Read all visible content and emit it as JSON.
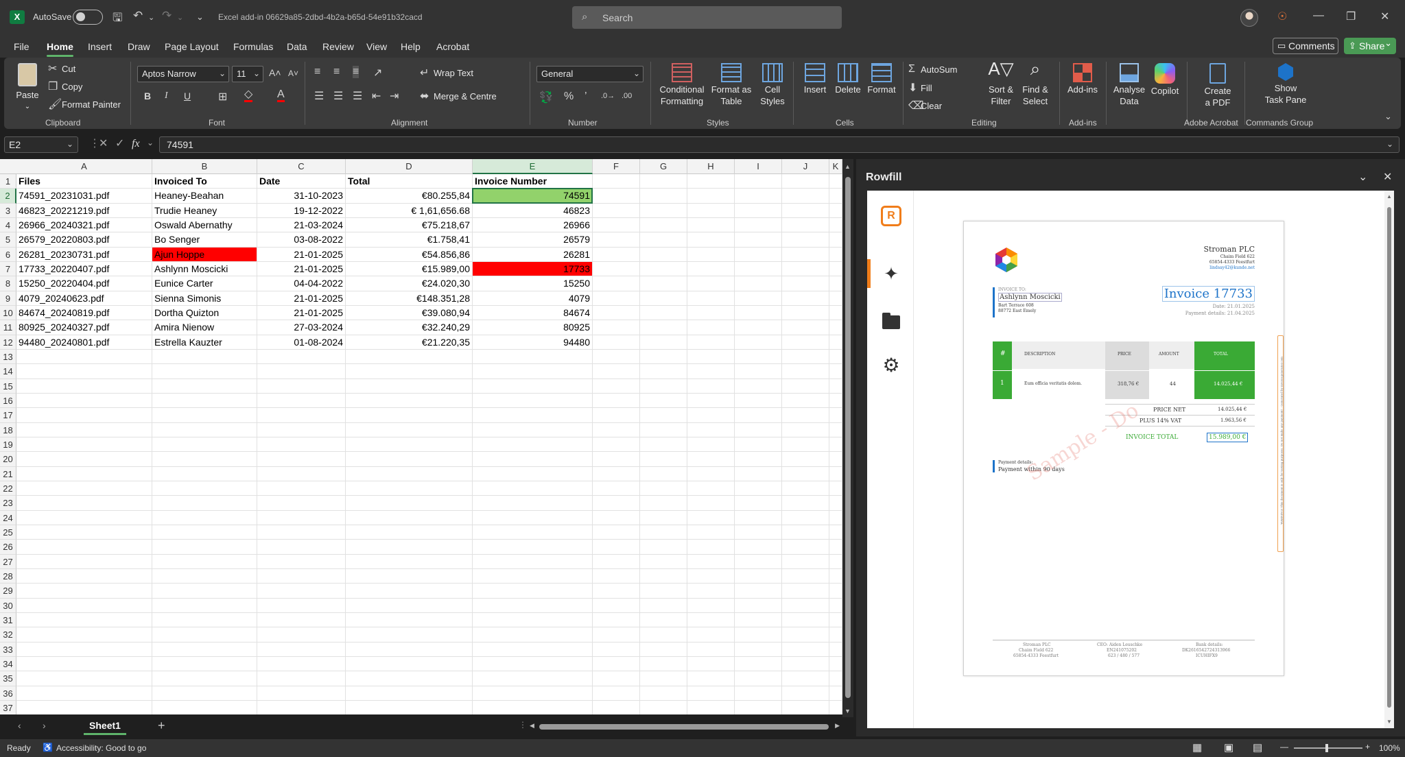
{
  "titlebar": {
    "app_logo": "X",
    "autosave_label": "AutoSave",
    "doc_title": "Excel add-in 06629a85-2dbd-4b2a-b65d-54e91b32cacd",
    "search_placeholder": "Search"
  },
  "menu": {
    "items": [
      "File",
      "Home",
      "Insert",
      "Draw",
      "Page Layout",
      "Formulas",
      "Data",
      "Review",
      "View",
      "Help",
      "Acrobat"
    ],
    "active": "Home",
    "comments_label": "Comments",
    "share_label": "Share"
  },
  "ribbon": {
    "clipboard": {
      "paste": "Paste",
      "cut": "Cut",
      "copy": "Copy",
      "format_painter": "Format Painter",
      "label": "Clipboard"
    },
    "font": {
      "family": "Aptos Narrow",
      "size": "11",
      "label": "Font"
    },
    "alignment": {
      "wrap_text": "Wrap Text",
      "merge": "Merge & Centre",
      "label": "Alignment"
    },
    "number": {
      "format": "General",
      "label": "Number"
    },
    "styles": {
      "conditional": [
        "Conditional",
        "Formatting"
      ],
      "format_table": [
        "Format as",
        "Table"
      ],
      "cell_styles": [
        "Cell",
        "Styles"
      ],
      "label": "Styles"
    },
    "cells": {
      "insert": "Insert",
      "delete": "Delete",
      "format": "Format",
      "label": "Cells"
    },
    "editing": {
      "autosum": "AutoSum",
      "fill": "Fill",
      "clear": "Clear",
      "sort": [
        "Sort &",
        "Filter"
      ],
      "find": [
        "Find &",
        "Select"
      ],
      "label": "Editing"
    },
    "addins": {
      "addins": "Add-ins",
      "label": "Add-ins"
    },
    "analyse": [
      "Analyse",
      "Data"
    ],
    "copilot": "Copilot",
    "acrobat": {
      "create": [
        "Create",
        "a PDF"
      ],
      "label": "Adobe Acrobat"
    },
    "commands": {
      "show": [
        "Show",
        "Task Pane"
      ],
      "label": "Commands Group"
    }
  },
  "formula_bar": {
    "name_box": "E2",
    "fx": "fx",
    "value": "74591"
  },
  "sheet": {
    "columns": [
      "A",
      "B",
      "C",
      "D",
      "E",
      "F",
      "G",
      "H",
      "I",
      "J",
      "K"
    ],
    "selected_column": "E",
    "selected_row": 2,
    "header": [
      "Files",
      "Invoiced To",
      "Date",
      "Total",
      "Invoice Number"
    ],
    "rows": [
      [
        "74591_20231031.pdf",
        "Heaney-Beahan",
        "31-10-2023",
        "€80.255,84",
        "74591"
      ],
      [
        "46823_20221219.pdf",
        "Trudie Heaney",
        "19-12-2022",
        "€ 1,61,656.68",
        "46823"
      ],
      [
        "26966_20240321.pdf",
        "Oswald Abernathy",
        "21-03-2024",
        "€75.218,67",
        "26966"
      ],
      [
        "26579_20220803.pdf",
        "Bo Senger",
        "03-08-2022",
        "€1.758,41",
        "26579"
      ],
      [
        "26281_20230731.pdf",
        "Ajun Hoppe",
        "21-01-2025",
        "€54.856,86",
        "26281"
      ],
      [
        "17733_20220407.pdf",
        "Ashlynn Moscicki",
        "21-01-2025",
        "€15.989,00",
        "17733"
      ],
      [
        "15250_20220404.pdf",
        "Eunice Carter",
        "04-04-2022",
        "€24.020,30",
        "15250"
      ],
      [
        "4079_20240623.pdf",
        "Sienna Simonis",
        "21-01-2025",
        "€148.351,28",
        "4079"
      ],
      [
        "84674_20240819.pdf",
        "Dortha Quizton",
        "21-01-2025",
        "€39.080,94",
        "84674"
      ],
      [
        "80925_20240327.pdf",
        "Amira Nienow",
        "27-03-2024",
        "€32.240,29",
        "80925"
      ],
      [
        "94480_20240801.pdf",
        "Estrella Kauzter",
        "01-08-2024",
        "€21.220,35",
        "94480"
      ]
    ],
    "highlights": {
      "green": "#92d26b",
      "red": "#ff0000"
    },
    "row_count": 37,
    "tab": "Sheet1"
  },
  "status": {
    "ready": "Ready",
    "accessibility": "Accessibility: Good to go",
    "zoom": "100%"
  },
  "pane": {
    "title": "Rowfill",
    "sidebar_icons": [
      "rowfill-logo-icon",
      "sparkle-icon",
      "folder-icon",
      "gear-icon"
    ],
    "invoice": {
      "company": "Stroman PLC",
      "address1": "Chaim Field 622",
      "address2": "65854-4333 Feestfurt",
      "email": "lindsay42@kunde.net",
      "invoice_to_label": "INVOICE TO:",
      "client": "Ashlynn Moscicki",
      "client_addr1": "Bart Terrace 608",
      "client_addr2": "88772 East Emely",
      "invoice_title": "Invoice 17733",
      "date": "Date: 21.01.2025",
      "payment_date": "Payment details: 21.04.2025",
      "table_head": [
        "#",
        "DESCRIPTION",
        "PRICE",
        "AMOUNT",
        "TOTAL"
      ],
      "table_row": [
        "1",
        "Eum officia veritatis dolom.",
        "318,76 €",
        "44",
        "14.025,44 €"
      ],
      "price_net_label": "PRICE NET",
      "price_net": "14.025,44 €",
      "vat_label": "PLUS 14% VAT",
      "vat": "1.963,56 €",
      "total_label": "INVOICE TOTAL",
      "total": "15.989,00 €",
      "payment_details_label": "Payment details:",
      "payment_terms": "Payment within 90 days",
      "watermark": "Sample - Do",
      "footer": [
        [
          "Stroman PLC",
          "Chaim Field 622",
          "65854-4333 Feestfurt"
        ],
        [
          "CEO: Aiden Leuschke",
          "EN241075202",
          "623 / 480 / 577"
        ],
        [
          "Bank details:",
          "DK2616542724313966",
          "ICUHIFX9"
        ]
      ],
      "side_note": "WARNING! This document is only for testing purposes. Do not make any payment! - Generated by invoicegenerator.com",
      "green": "#3aaa35",
      "blue": "#1d73c9"
    }
  }
}
